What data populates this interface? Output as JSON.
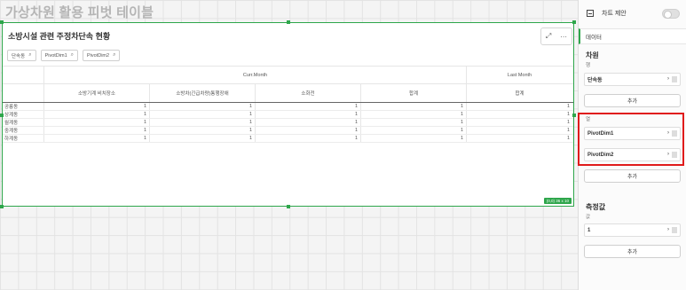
{
  "sheet": {
    "title": "가상차원 활용 피벗 테이블"
  },
  "object": {
    "title": "소방시설 관련 주정차단속 현황",
    "toolbar": {
      "expand_glyph": "⤢",
      "more_glyph": "···"
    },
    "chips": [
      "단속동",
      "PivotDim1",
      "PivotDim2"
    ],
    "size_badge": "(0,0) 36 x 10"
  },
  "pivot": {
    "header1": {
      "curr": "Curr.Month",
      "last": "Last Month"
    },
    "header2": [
      "소방기계 비치장소",
      "소방차(긴급차량)통행장애",
      "소화전",
      "합계",
      "합계"
    ],
    "rows": [
      {
        "label": "공릉동",
        "values": [
          "1",
          "1",
          "1",
          "1",
          "1"
        ]
      },
      {
        "label": "상계동",
        "values": [
          "1",
          "1",
          "1",
          "1",
          "1"
        ]
      },
      {
        "label": "월계동",
        "values": [
          "1",
          "1",
          "1",
          "1",
          "1"
        ]
      },
      {
        "label": "중계동",
        "values": [
          "1",
          "1",
          "1",
          "1",
          "1"
        ]
      },
      {
        "label": "하계동",
        "values": [
          "1",
          "1",
          "1",
          "1",
          "1"
        ]
      }
    ]
  },
  "panel": {
    "top_label": "차트 제안",
    "tab_data": "데이터",
    "dimensions": {
      "title": "차원",
      "row_label": "행",
      "row_field": "단속동",
      "add": "추가"
    },
    "columns": {
      "label": "열",
      "fields": [
        "PivotDim1",
        "PivotDim2"
      ],
      "add": "추가"
    },
    "measures": {
      "title": "측정값",
      "label": "값",
      "field": "1",
      "add": "추가"
    }
  },
  "colors": {
    "accent": "#2ea64b",
    "highlight": "#e01b1b"
  }
}
